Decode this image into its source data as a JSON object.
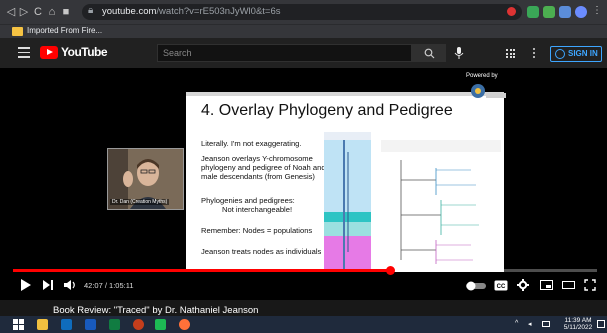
{
  "browser": {
    "url_host": "youtube.com",
    "url_path": "/watch?v=rE503nJyWl0&t=6s",
    "bookmark_label": "Imported From Fire...",
    "colors": {
      "chrome": "#35363a",
      "urlbar": "#202124"
    }
  },
  "youtube": {
    "logo_text": "YouTube",
    "search_placeholder": "Search",
    "signin_label": "SIGN IN",
    "colors": {
      "brand_red": "#ff0000",
      "link_blue": "#3ea6ff"
    }
  },
  "slide": {
    "title": "4. Overlay Phylogeny and Pedigree",
    "lines": [
      "Literally. I'm not exaggerating.",
      "Jeanson overlays Y-chromosome phylogeny and pedigree of Noah and male descendants (from Genesis)",
      "Phylogenies and pedigrees:",
      "Not interchangeable!",
      "Remember: Nodes = populations",
      "Jeanson treats nodes as individuals"
    ],
    "powered_by": "Powered by",
    "presenter_label": "Dr. Dan (Creation Myths)"
  },
  "player": {
    "time_current": "42:07",
    "time_total": "1:05:11",
    "time_display": "42:07 / 1:05:11",
    "progress": 0.646
  },
  "video": {
    "title": "Book Review: \"Traced\" by Dr. Nathaniel Jeanson"
  },
  "taskbar": {
    "time": "11:39 AM",
    "date": "5/11/2022"
  }
}
